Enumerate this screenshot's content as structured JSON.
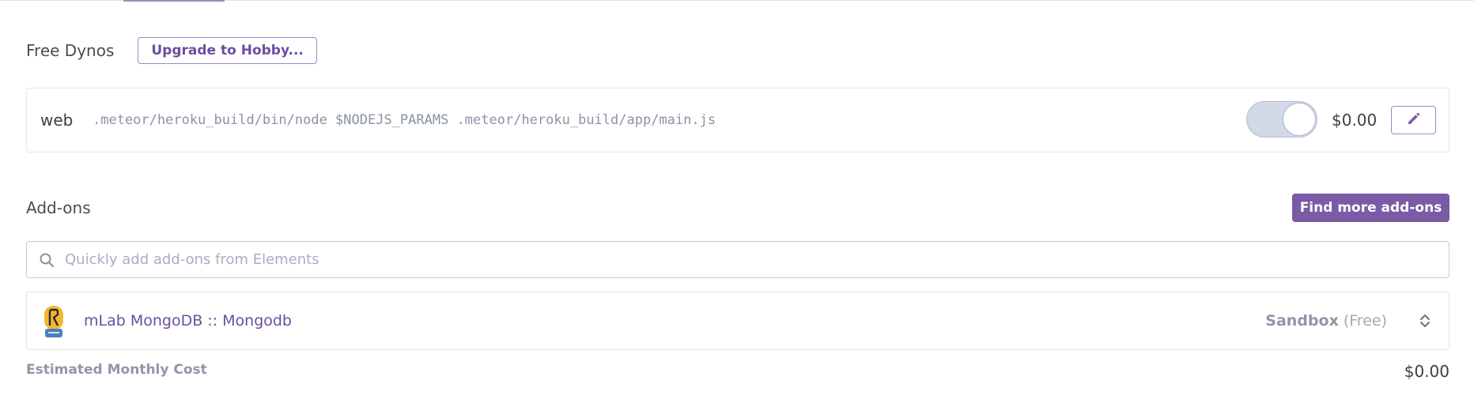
{
  "dynos": {
    "section_title": "Free Dynos",
    "upgrade_label": "Upgrade to Hobby...",
    "process": {
      "type": "web",
      "command": ".meteor/heroku_build/bin/node $NODEJS_PARAMS .meteor/heroku_build/app/main.js",
      "enabled": true,
      "price": "$0.00",
      "edit_icon": "pencil-icon"
    }
  },
  "addons": {
    "section_title": "Add-ons",
    "find_more_label": "Find more add-ons",
    "search": {
      "placeholder": "Quickly add add-ons from Elements",
      "value": "",
      "icon": "search-icon"
    },
    "items": [
      {
        "name": "mLab MongoDB :: Mongodb",
        "plan": "Sandbox",
        "tier": "(Free)",
        "logo_icon": "mlab-logo-icon",
        "toggle_icon": "chevron-up-down-icon"
      }
    ]
  },
  "estimate": {
    "label": "Estimated Monthly Cost",
    "value": "$0.00"
  },
  "colors": {
    "accent": "#79589f",
    "button_fill": "#7b5aa6",
    "muted_text": "#8f97a7",
    "toggle_track": "#d1d8e6"
  }
}
